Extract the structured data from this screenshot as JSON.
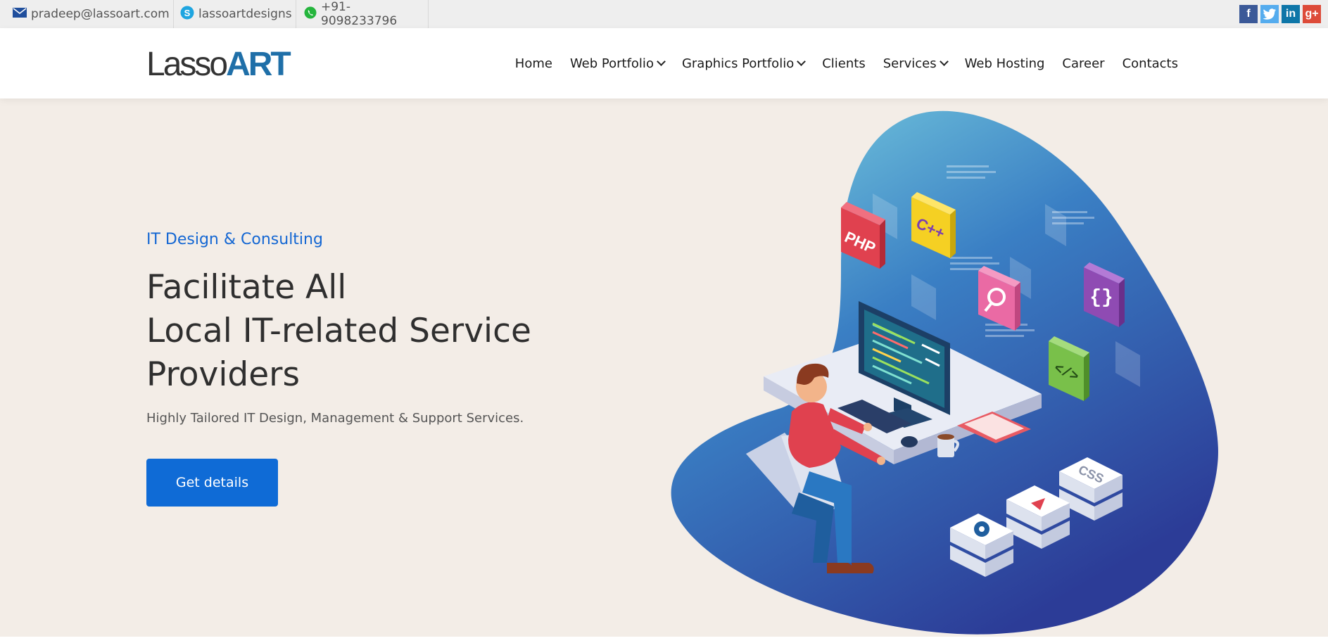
{
  "topbar": {
    "email": "pradeep@lassoart.com",
    "skype": "lassoartdesigns",
    "phone": "+91-9098233796",
    "social": [
      {
        "name": "facebook",
        "glyph": "f",
        "color": "#3b5998"
      },
      {
        "name": "twitter",
        "glyph": "t",
        "color": "#55acee"
      },
      {
        "name": "linkedin",
        "glyph": "in",
        "color": "#0e76a8"
      },
      {
        "name": "google-plus",
        "glyph": "g+",
        "color": "#dd4b39"
      }
    ]
  },
  "logo": {
    "main": "Lasso",
    "accent": "ART"
  },
  "nav": {
    "items": [
      {
        "label": "Home",
        "dropdown": false
      },
      {
        "label": "Web Portfolio",
        "dropdown": true
      },
      {
        "label": "Graphics Portfolio",
        "dropdown": true
      },
      {
        "label": "Clients",
        "dropdown": false
      },
      {
        "label": "Services",
        "dropdown": true
      },
      {
        "label": "Web Hosting",
        "dropdown": false
      },
      {
        "label": "Career",
        "dropdown": false
      },
      {
        "label": "Contacts",
        "dropdown": false
      }
    ]
  },
  "hero": {
    "eyebrow": "IT Design & Consulting",
    "headline": [
      "Facilitate All",
      "Local IT-related Service",
      "Providers"
    ],
    "subtext": "Highly Tailored IT Design, Management & Support Services.",
    "cta": "Get details",
    "illustration_labels": {
      "php": "PHP",
      "cpp": "C++",
      "braces": "{}",
      "code": "</>",
      "css": "CSS"
    }
  },
  "colors": {
    "accent": "#1467d3",
    "button": "#0f6bd6",
    "hero_bg": "#f3ede7",
    "blob_top": "#7ed3e0",
    "blob_bottom": "#2c3f9c"
  }
}
